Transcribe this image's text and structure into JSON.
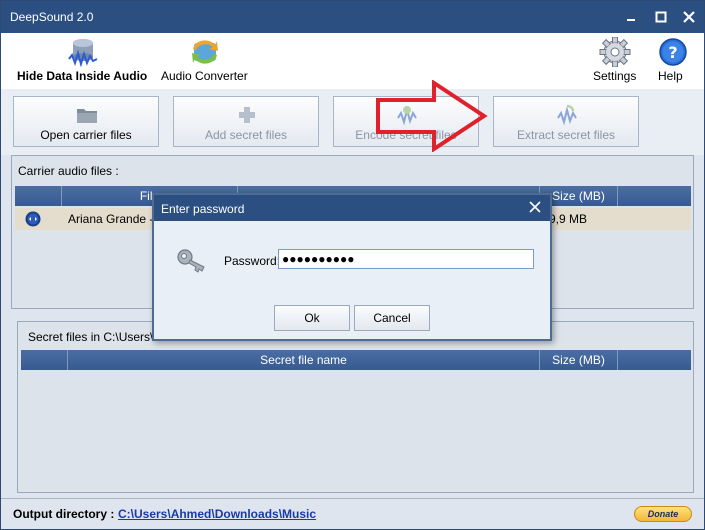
{
  "window": {
    "title": "DeepSound 2.0"
  },
  "toolbar": {
    "hide_data": "Hide Data Inside Audio",
    "audio_converter": "Audio Converter",
    "settings": "Settings",
    "help": "Help"
  },
  "actions": {
    "open_carrier": "Open carrier files",
    "add_secret": "Add secret files",
    "encode_secret": "Encode secret files",
    "extract_secret": "Extract secret files"
  },
  "carrier": {
    "label": "Carrier audio files :",
    "columns": {
      "file": "File",
      "size": "Size (MB)"
    },
    "rows": [
      {
        "name": "Ariana Grande -",
        "size": "9,9 MB"
      }
    ]
  },
  "secret": {
    "label": "Secret files in C:\\Users\\A",
    "columns": {
      "name": "Secret file name",
      "size": "Size (MB)"
    }
  },
  "footer": {
    "output_label": "Output directory :",
    "output_path": "C:\\Users\\Ahmed\\Downloads\\Music",
    "donate": "Donate"
  },
  "dialog": {
    "title": "Enter password",
    "password_label": "Password:",
    "password_value": "●●●●●●●●●●",
    "ok": "Ok",
    "cancel": "Cancel"
  },
  "colors": {
    "titlebar": "#2b4f80",
    "grid_header": "#3d6196",
    "selected_row": "#e4dccd",
    "annotation_arrow": "#e0202a",
    "link": "#1b39a8"
  },
  "icons": {
    "hide_data": "database-audio-icon",
    "audio_converter": "convert-icon",
    "settings": "gear-icon",
    "help": "help-icon",
    "open_carrier": "folder-icon",
    "add_secret": "plus-icon",
    "encode_secret": "encode-icon",
    "extract_secret": "extract-icon",
    "dialog": "key-icon"
  }
}
